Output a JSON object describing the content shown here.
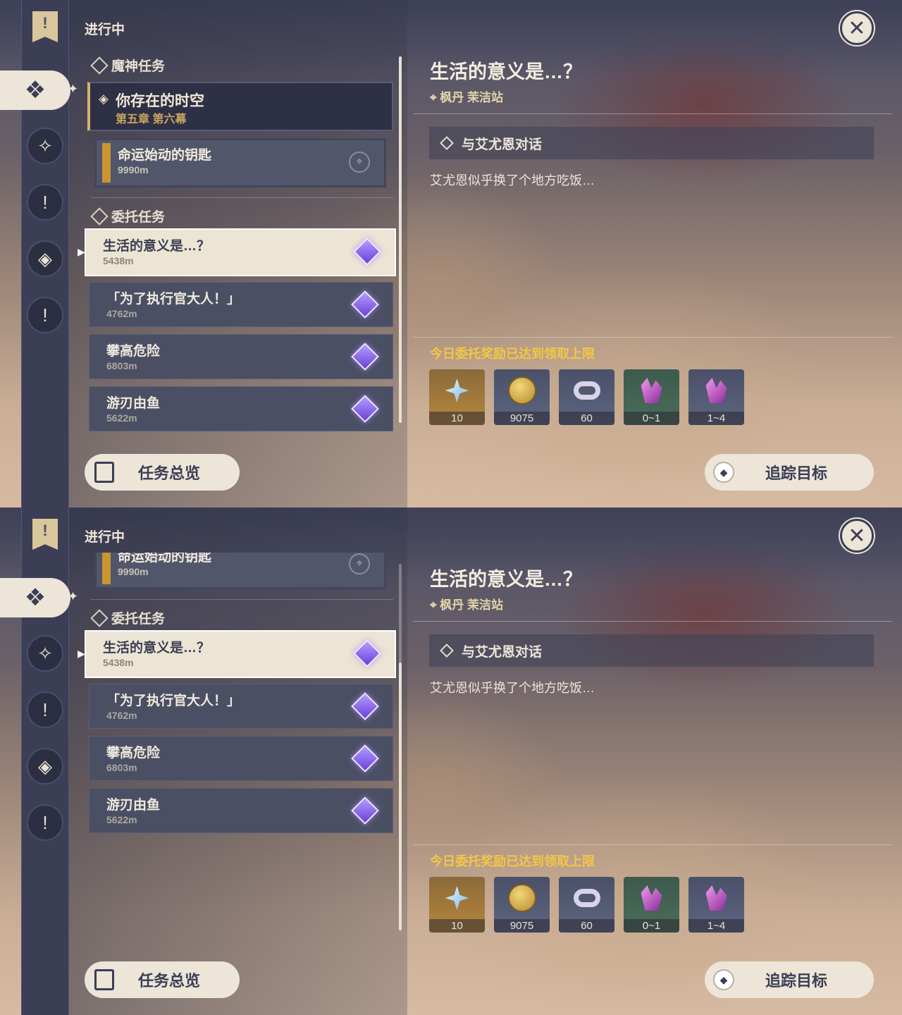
{
  "panels": [
    {
      "status_title": "进行中",
      "sections": {
        "archon": "魔神任务",
        "commission": "委托任务"
      },
      "main_quest": {
        "title": "你存在的时空",
        "subtitle": "第五章 第六幕"
      },
      "sub_quest": {
        "title": "命运始动的钥匙",
        "distance": "9990m"
      },
      "commissions": [
        {
          "title": "生活的意义是…？",
          "distance": "5438m",
          "selected": true
        },
        {
          "title": "「为了执行官大人！」",
          "distance": "4762m",
          "selected": false
        },
        {
          "title": "攀高危险",
          "distance": "6803m",
          "selected": false
        },
        {
          "title": "游刃由鱼",
          "distance": "5622m",
          "selected": false
        }
      ]
    },
    {
      "status_title": "进行中",
      "sections": {
        "commission": "委托任务"
      },
      "sub_quest": {
        "title": "命运始动的钥匙",
        "distance": "9990m"
      },
      "commissions": [
        {
          "title": "生活的意义是…？",
          "distance": "5438m",
          "selected": true
        },
        {
          "title": "「为了执行官大人！」",
          "distance": "4762m",
          "selected": false
        },
        {
          "title": "攀高危险",
          "distance": "6803m",
          "selected": false
        },
        {
          "title": "游刃由鱼",
          "distance": "5622m",
          "selected": false
        }
      ]
    }
  ],
  "detail": {
    "title": "生活的意义是…？",
    "location": "枫丹 茉洁站",
    "objective": "与艾尤恩对话",
    "description": "艾尤恩似乎换了个地方吃饭…",
    "reward_message": "今日委托奖励已达到领取上限",
    "rewards": [
      {
        "icon": "primogem-icon",
        "count": "10"
      },
      {
        "icon": "mora-icon",
        "count": "9075"
      },
      {
        "icon": "adventure-exp-icon",
        "count": "60"
      },
      {
        "icon": "crystal-chunk-icon",
        "count": "0~1"
      },
      {
        "icon": "crystal-cluster-icon",
        "count": "1~4"
      }
    ]
  },
  "buttons": {
    "overview": "任务总览",
    "track": "追踪目标"
  },
  "colors": {
    "accent_gold": "#f2c744",
    "ui_cream": "#ece5d8",
    "ui_dark": "#3b3e55",
    "commission_star": "#8f6cf0"
  }
}
